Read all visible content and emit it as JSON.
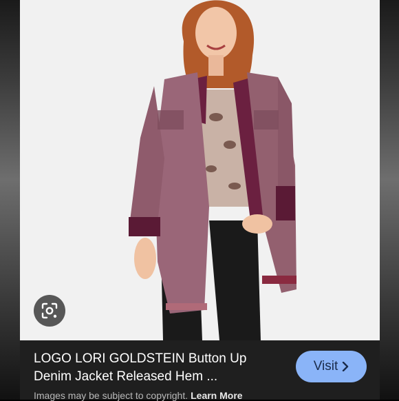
{
  "result": {
    "title": "LOGO LORI GOLDSTEIN Button Up Denim Jacket Released Hem ...",
    "visit_label": "Visit",
    "disclaimer": "Images may be subject to copyright.",
    "learn_more_label": "Learn More"
  },
  "icons": {
    "lens": "google-lens-icon",
    "visit_chevron": "chevron-right-icon"
  },
  "colors": {
    "info_bar_bg": "#1f1f1f",
    "visit_button_bg": "#8ab4f8",
    "photo_bg": "#f1f1f1"
  }
}
